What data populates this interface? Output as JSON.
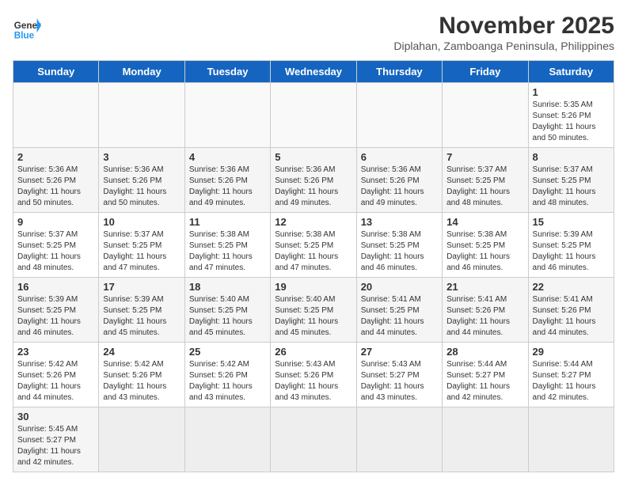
{
  "header": {
    "logo_general": "General",
    "logo_blue": "Blue",
    "month_title": "November 2025",
    "subtitle": "Diplahan, Zamboanga Peninsula, Philippines"
  },
  "days_of_week": [
    "Sunday",
    "Monday",
    "Tuesday",
    "Wednesday",
    "Thursday",
    "Friday",
    "Saturday"
  ],
  "weeks": [
    [
      {
        "day": "",
        "sunrise": "",
        "sunset": "",
        "daylight": "",
        "empty": true
      },
      {
        "day": "",
        "sunrise": "",
        "sunset": "",
        "daylight": "",
        "empty": true
      },
      {
        "day": "",
        "sunrise": "",
        "sunset": "",
        "daylight": "",
        "empty": true
      },
      {
        "day": "",
        "sunrise": "",
        "sunset": "",
        "daylight": "",
        "empty": true
      },
      {
        "day": "",
        "sunrise": "",
        "sunset": "",
        "daylight": "",
        "empty": true
      },
      {
        "day": "",
        "sunrise": "",
        "sunset": "",
        "daylight": "",
        "empty": true
      },
      {
        "day": "1",
        "sunrise": "Sunrise: 5:35 AM",
        "sunset": "Sunset: 5:26 PM",
        "daylight": "Daylight: 11 hours and 50 minutes.",
        "empty": false
      }
    ],
    [
      {
        "day": "2",
        "sunrise": "Sunrise: 5:36 AM",
        "sunset": "Sunset: 5:26 PM",
        "daylight": "Daylight: 11 hours and 50 minutes.",
        "empty": false
      },
      {
        "day": "3",
        "sunrise": "Sunrise: 5:36 AM",
        "sunset": "Sunset: 5:26 PM",
        "daylight": "Daylight: 11 hours and 50 minutes.",
        "empty": false
      },
      {
        "day": "4",
        "sunrise": "Sunrise: 5:36 AM",
        "sunset": "Sunset: 5:26 PM",
        "daylight": "Daylight: 11 hours and 49 minutes.",
        "empty": false
      },
      {
        "day": "5",
        "sunrise": "Sunrise: 5:36 AM",
        "sunset": "Sunset: 5:26 PM",
        "daylight": "Daylight: 11 hours and 49 minutes.",
        "empty": false
      },
      {
        "day": "6",
        "sunrise": "Sunrise: 5:36 AM",
        "sunset": "Sunset: 5:26 PM",
        "daylight": "Daylight: 11 hours and 49 minutes.",
        "empty": false
      },
      {
        "day": "7",
        "sunrise": "Sunrise: 5:37 AM",
        "sunset": "Sunset: 5:25 PM",
        "daylight": "Daylight: 11 hours and 48 minutes.",
        "empty": false
      },
      {
        "day": "8",
        "sunrise": "Sunrise: 5:37 AM",
        "sunset": "Sunset: 5:25 PM",
        "daylight": "Daylight: 11 hours and 48 minutes.",
        "empty": false
      }
    ],
    [
      {
        "day": "9",
        "sunrise": "Sunrise: 5:37 AM",
        "sunset": "Sunset: 5:25 PM",
        "daylight": "Daylight: 11 hours and 48 minutes.",
        "empty": false
      },
      {
        "day": "10",
        "sunrise": "Sunrise: 5:37 AM",
        "sunset": "Sunset: 5:25 PM",
        "daylight": "Daylight: 11 hours and 47 minutes.",
        "empty": false
      },
      {
        "day": "11",
        "sunrise": "Sunrise: 5:38 AM",
        "sunset": "Sunset: 5:25 PM",
        "daylight": "Daylight: 11 hours and 47 minutes.",
        "empty": false
      },
      {
        "day": "12",
        "sunrise": "Sunrise: 5:38 AM",
        "sunset": "Sunset: 5:25 PM",
        "daylight": "Daylight: 11 hours and 47 minutes.",
        "empty": false
      },
      {
        "day": "13",
        "sunrise": "Sunrise: 5:38 AM",
        "sunset": "Sunset: 5:25 PM",
        "daylight": "Daylight: 11 hours and 46 minutes.",
        "empty": false
      },
      {
        "day": "14",
        "sunrise": "Sunrise: 5:38 AM",
        "sunset": "Sunset: 5:25 PM",
        "daylight": "Daylight: 11 hours and 46 minutes.",
        "empty": false
      },
      {
        "day": "15",
        "sunrise": "Sunrise: 5:39 AM",
        "sunset": "Sunset: 5:25 PM",
        "daylight": "Daylight: 11 hours and 46 minutes.",
        "empty": false
      }
    ],
    [
      {
        "day": "16",
        "sunrise": "Sunrise: 5:39 AM",
        "sunset": "Sunset: 5:25 PM",
        "daylight": "Daylight: 11 hours and 46 minutes.",
        "empty": false
      },
      {
        "day": "17",
        "sunrise": "Sunrise: 5:39 AM",
        "sunset": "Sunset: 5:25 PM",
        "daylight": "Daylight: 11 hours and 45 minutes.",
        "empty": false
      },
      {
        "day": "18",
        "sunrise": "Sunrise: 5:40 AM",
        "sunset": "Sunset: 5:25 PM",
        "daylight": "Daylight: 11 hours and 45 minutes.",
        "empty": false
      },
      {
        "day": "19",
        "sunrise": "Sunrise: 5:40 AM",
        "sunset": "Sunset: 5:25 PM",
        "daylight": "Daylight: 11 hours and 45 minutes.",
        "empty": false
      },
      {
        "day": "20",
        "sunrise": "Sunrise: 5:41 AM",
        "sunset": "Sunset: 5:25 PM",
        "daylight": "Daylight: 11 hours and 44 minutes.",
        "empty": false
      },
      {
        "day": "21",
        "sunrise": "Sunrise: 5:41 AM",
        "sunset": "Sunset: 5:26 PM",
        "daylight": "Daylight: 11 hours and 44 minutes.",
        "empty": false
      },
      {
        "day": "22",
        "sunrise": "Sunrise: 5:41 AM",
        "sunset": "Sunset: 5:26 PM",
        "daylight": "Daylight: 11 hours and 44 minutes.",
        "empty": false
      }
    ],
    [
      {
        "day": "23",
        "sunrise": "Sunrise: 5:42 AM",
        "sunset": "Sunset: 5:26 PM",
        "daylight": "Daylight: 11 hours and 44 minutes.",
        "empty": false
      },
      {
        "day": "24",
        "sunrise": "Sunrise: 5:42 AM",
        "sunset": "Sunset: 5:26 PM",
        "daylight": "Daylight: 11 hours and 43 minutes.",
        "empty": false
      },
      {
        "day": "25",
        "sunrise": "Sunrise: 5:42 AM",
        "sunset": "Sunset: 5:26 PM",
        "daylight": "Daylight: 11 hours and 43 minutes.",
        "empty": false
      },
      {
        "day": "26",
        "sunrise": "Sunrise: 5:43 AM",
        "sunset": "Sunset: 5:26 PM",
        "daylight": "Daylight: 11 hours and 43 minutes.",
        "empty": false
      },
      {
        "day": "27",
        "sunrise": "Sunrise: 5:43 AM",
        "sunset": "Sunset: 5:27 PM",
        "daylight": "Daylight: 11 hours and 43 minutes.",
        "empty": false
      },
      {
        "day": "28",
        "sunrise": "Sunrise: 5:44 AM",
        "sunset": "Sunset: 5:27 PM",
        "daylight": "Daylight: 11 hours and 42 minutes.",
        "empty": false
      },
      {
        "day": "29",
        "sunrise": "Sunrise: 5:44 AM",
        "sunset": "Sunset: 5:27 PM",
        "daylight": "Daylight: 11 hours and 42 minutes.",
        "empty": false
      }
    ],
    [
      {
        "day": "30",
        "sunrise": "Sunrise: 5:45 AM",
        "sunset": "Sunset: 5:27 PM",
        "daylight": "Daylight: 11 hours and 42 minutes.",
        "empty": false
      },
      {
        "day": "",
        "sunrise": "",
        "sunset": "",
        "daylight": "",
        "empty": true
      },
      {
        "day": "",
        "sunrise": "",
        "sunset": "",
        "daylight": "",
        "empty": true
      },
      {
        "day": "",
        "sunrise": "",
        "sunset": "",
        "daylight": "",
        "empty": true
      },
      {
        "day": "",
        "sunrise": "",
        "sunset": "",
        "daylight": "",
        "empty": true
      },
      {
        "day": "",
        "sunrise": "",
        "sunset": "",
        "daylight": "",
        "empty": true
      },
      {
        "day": "",
        "sunrise": "",
        "sunset": "",
        "daylight": "",
        "empty": true
      }
    ]
  ]
}
